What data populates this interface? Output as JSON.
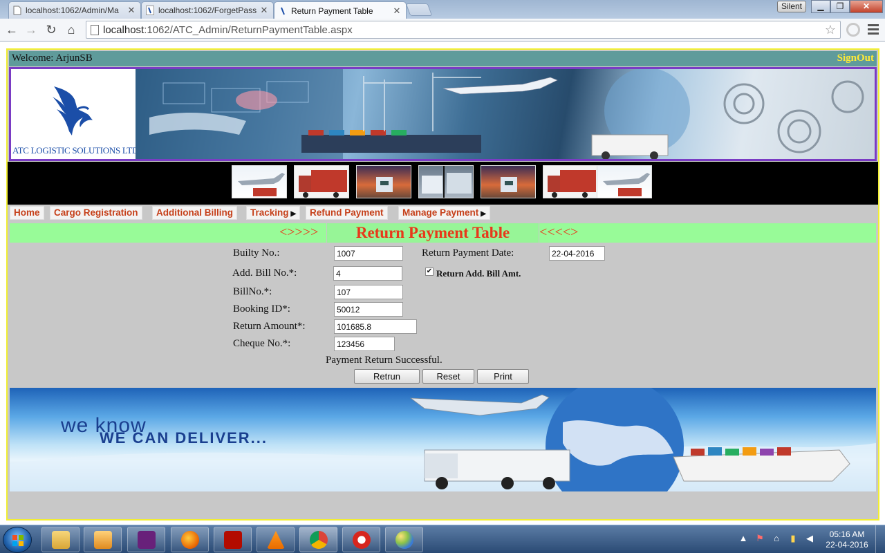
{
  "browser": {
    "tabs": [
      {
        "label": "localhost:1062/Admin/Ma",
        "active": false
      },
      {
        "label": "localhost:1062/ForgetPass",
        "active": false
      },
      {
        "label": "Return Payment Table",
        "active": true
      }
    ],
    "silent_badge": "Silent",
    "url_host": "localhost",
    "url_path": ":1062/ATC_Admin/ReturnPaymentTable.aspx"
  },
  "site": {
    "welcome": "Welcome: ArjunSB",
    "signout": "SignOut",
    "logo_text": "ATC LOGISTIC SOLUTIONS LTD.,",
    "nav": [
      {
        "label": "Home",
        "has_arrow": false
      },
      {
        "label": "Cargo Registration",
        "has_arrow": false
      },
      {
        "label": "Additional Billing",
        "has_arrow": false
      },
      {
        "label": "Tracking",
        "has_arrow": true
      },
      {
        "label": "Refund Payment",
        "has_arrow": false
      },
      {
        "label": "Manage Payment",
        "has_arrow": true
      }
    ],
    "title_left": "<>>>>",
    "title": "Return Payment Table",
    "title_right": "<<<<>",
    "form": {
      "builty_label": "Builty No.:",
      "builty_value": "1007",
      "return_date_label": "Return Payment Date:",
      "return_date_value": "22-04-2016",
      "add_bill_label": "Add. Bill No.*:",
      "add_bill_value": "4",
      "return_add_bill_label": "Return Add. Bill Amt.",
      "return_add_bill_checked": true,
      "bill_no_label": "BillNo.*:",
      "bill_no_value": "107",
      "booking_label": "Booking ID*:",
      "booking_value": "50012",
      "return_amount_label": "Return Amount*:",
      "return_amount_value": "101685.8",
      "cheque_label": "Cheque No.*:",
      "cheque_value": "123456",
      "status": "Payment Return Successful.",
      "buttons": {
        "return": "Retrun",
        "reset": "Reset",
        "print": "Print"
      }
    },
    "footer_banner": {
      "line1": "we know",
      "line2": "WE CAN DELIVER..."
    }
  },
  "taskbar": {
    "time": "05:16 AM",
    "date": "22-04-2016"
  },
  "colors": {
    "accent_red": "#e8381a",
    "welcome_bg": "#5f9b9b",
    "title_bg": "#98fb98",
    "signout": "#ffea36",
    "header_border": "#7a3bc4"
  }
}
